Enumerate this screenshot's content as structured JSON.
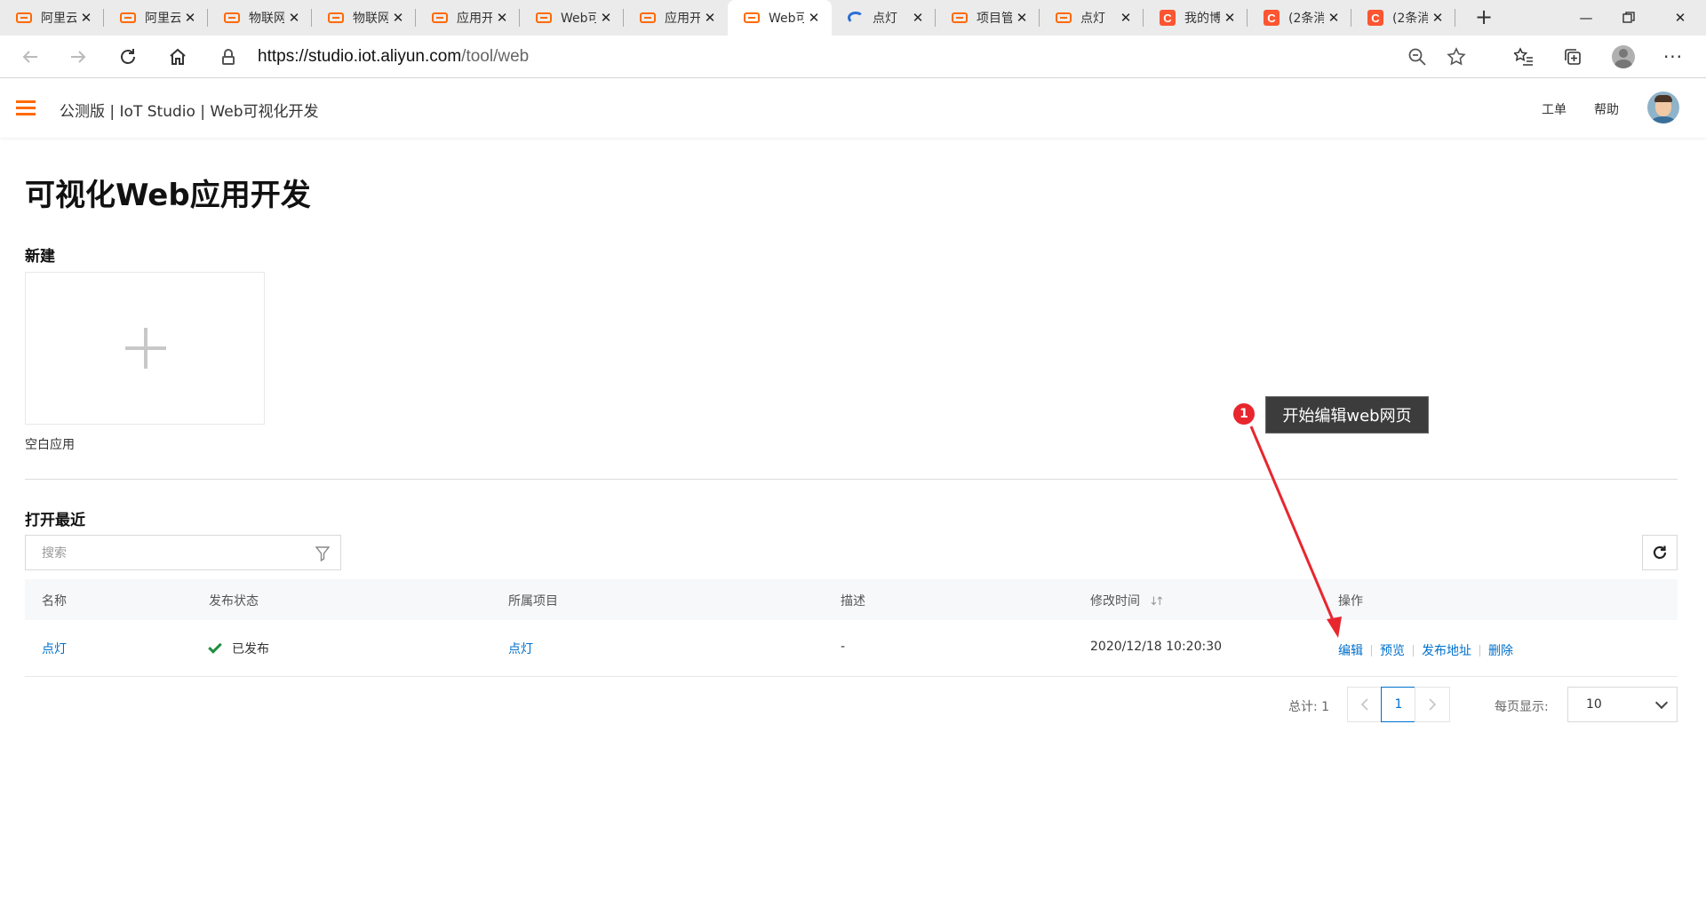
{
  "browser": {
    "tabs": [
      {
        "label": "阿里云",
        "favicon": "aliyun-icon",
        "active": false
      },
      {
        "label": "阿里云",
        "favicon": "aliyun-icon",
        "active": false
      },
      {
        "label": "物联网",
        "favicon": "aliyun-icon",
        "active": false
      },
      {
        "label": "物联网",
        "favicon": "aliyun-icon",
        "active": false
      },
      {
        "label": "应用开",
        "favicon": "aliyun-icon",
        "active": false
      },
      {
        "label": "Web可",
        "favicon": "aliyun-icon",
        "active": false
      },
      {
        "label": "应用开",
        "favicon": "aliyun-icon",
        "active": false
      },
      {
        "label": "Web可",
        "favicon": "aliyun-icon",
        "active": true
      },
      {
        "label": "点灯",
        "favicon": "loading-icon",
        "active": false
      },
      {
        "label": "项目管",
        "favicon": "aliyun-icon",
        "active": false
      },
      {
        "label": "点灯",
        "favicon": "aliyun-icon",
        "active": false
      },
      {
        "label": "我的博",
        "favicon": "csdn-icon",
        "active": false
      },
      {
        "label": "(2条消",
        "favicon": "csdn-icon",
        "active": false
      },
      {
        "label": "(2条消",
        "favicon": "csdn-icon",
        "active": false
      }
    ],
    "csdn_glyph": "C",
    "url": {
      "host": "https://studio.iot.aliyun.com",
      "path": "/tool/web"
    },
    "icons": {
      "back": "back-arrow-icon",
      "forward": "forward-arrow-icon",
      "reload": "reload-icon",
      "home": "home-icon",
      "zoom": "zoom-icon",
      "favorite": "star-icon",
      "favorites_list": "favorites-list-icon",
      "collections": "collections-icon",
      "profile": "profile-icon",
      "more": "more-icon"
    }
  },
  "app": {
    "title": "公测版 | IoT Studio | Web可视化开发",
    "nav": {
      "ticket": "工单",
      "help": "帮助"
    },
    "accent": "#ff6a00"
  },
  "main": {
    "page_title": "可视化Web应用开发",
    "new_section": {
      "heading": "新建",
      "card_caption": "空白应用"
    },
    "recent_section": {
      "heading": "打开最近"
    },
    "search": {
      "placeholder": "搜索",
      "value": ""
    },
    "table": {
      "columns": [
        "名称",
        "发布状态",
        "所属项目",
        "描述",
        "修改时间",
        "操作"
      ],
      "rows": [
        {
          "name": "点灯",
          "status": "已发布",
          "project": "点灯",
          "description": "-",
          "modified": "2020/12/18 10:20:30",
          "actions": [
            "编辑",
            "预览",
            "发布地址",
            "删除"
          ]
        }
      ]
    },
    "pagination": {
      "total_label": "总计: 1",
      "current_page": "1",
      "page_size_label": "每页显示:",
      "page_size": "10"
    },
    "link_color": "#0070cc",
    "status_color": "#1e8e3e"
  },
  "annotation": {
    "number": "1",
    "text": "开始编辑web网页",
    "color": "#e8262e"
  }
}
